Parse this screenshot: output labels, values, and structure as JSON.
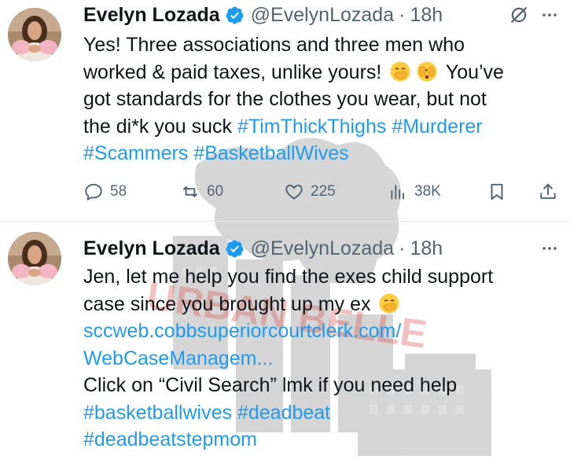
{
  "tweets": [
    {
      "name": "Evelyn Lozada",
      "handle": "@EvelynLozada",
      "separator": "·",
      "time": "18h",
      "lines": [
        {
          "text": "Yes! Three associations and three men who"
        },
        {
          "text": "worked & paid taxes, unlike yours!",
          "emojis": [
            "hand-over-mouth-emoji",
            "peeking-face-emoji"
          ],
          "tail": "You’ve"
        },
        {
          "text": "got standards for the clothes you wear, but not"
        },
        {
          "text": "the di*k you suck",
          "hashtags": [
            "#TimThickThighs",
            "#Murderer"
          ]
        },
        {
          "hashtags": [
            "#Scammers",
            "#BasketballWives"
          ]
        }
      ],
      "stats": {
        "replies": "58",
        "retweets": "60",
        "likes": "225",
        "views": "38K"
      }
    },
    {
      "name": "Evelyn Lozada",
      "handle": "@EvelynLozada",
      "separator": "·",
      "time": "18h",
      "lines": [
        {
          "text": "Jen, let me help you find the exes child support"
        },
        {
          "text": "case since you brought up my ex",
          "emojis": [
            "hand-over-mouth-emoji"
          ]
        },
        {
          "link": "sccweb.cobbsuperiorcourtclerk.com/"
        },
        {
          "link": "WebCaseManagem..."
        },
        {
          "text": "Click on “Civil Search” lmk if you need help"
        },
        {
          "hashtags": [
            "#basketballwives",
            "#deadbeat"
          ]
        },
        {
          "hashtags": [
            "#deadbeatstepmom"
          ]
        }
      ]
    }
  ],
  "watermark": {
    "text": "URBAN BELLE"
  },
  "colors": {
    "link": "#1d9bf0",
    "verified": "#1d9bf0",
    "muted": "#536471",
    "text": "#0f1419"
  }
}
